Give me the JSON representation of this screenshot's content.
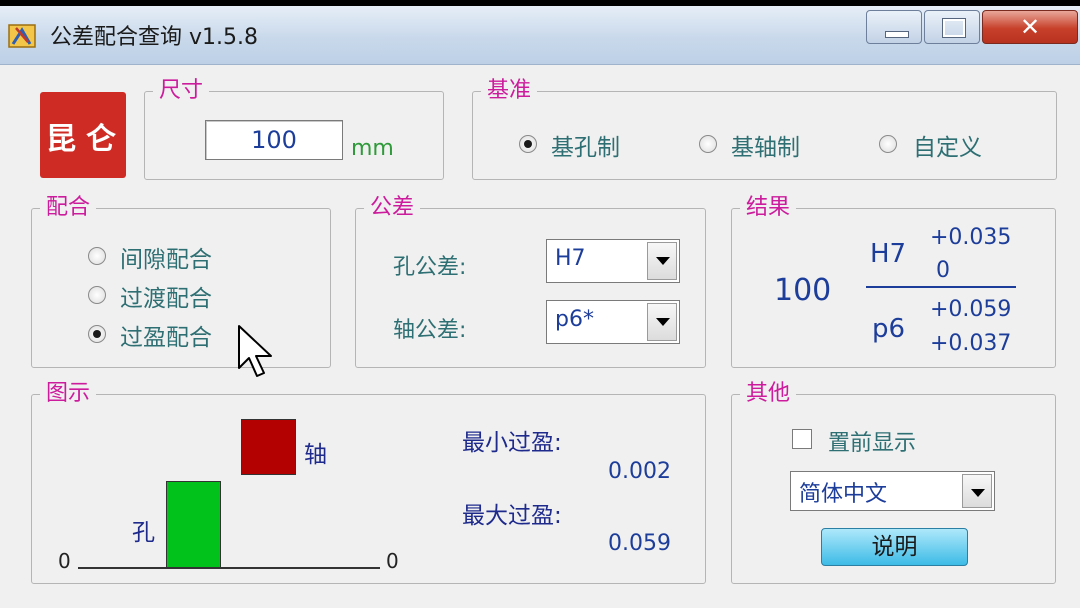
{
  "window": {
    "title": "公差配合查询  v1.5.8"
  },
  "seal": {
    "chars": [
      "昆",
      "仑"
    ]
  },
  "size": {
    "legend": "尺寸",
    "value": "100",
    "unit": "mm"
  },
  "basis": {
    "legend": "基准",
    "options": [
      {
        "label": "基孔制",
        "selected": true
      },
      {
        "label": "基轴制",
        "selected": false
      },
      {
        "label": "自定义",
        "selected": false
      }
    ]
  },
  "fit": {
    "legend": "配合",
    "options": [
      {
        "label": "间隙配合",
        "selected": false
      },
      {
        "label": "过渡配合",
        "selected": false
      },
      {
        "label": "过盈配合",
        "selected": true
      }
    ]
  },
  "tolerance": {
    "legend": "公差",
    "hole_label": "孔公差:",
    "hole_value": "H7",
    "shaft_label": "轴公差:",
    "shaft_value": "p6*"
  },
  "result": {
    "legend": "结果",
    "size": "100",
    "hole_code": "H7",
    "hole_upper": "+0.035",
    "hole_lower": "0",
    "shaft_code": "p6",
    "shaft_upper": "+0.059",
    "shaft_lower": "+0.037"
  },
  "diagram": {
    "legend": "图示",
    "shaft_label": "轴",
    "hole_label": "孔",
    "axis_left": "0",
    "axis_right": "0",
    "hole_color": "#00c21a",
    "shaft_color": "#b30000",
    "min_label": "最小过盈:",
    "min_value": "0.002",
    "max_label": "最大过盈:",
    "max_value": "0.059"
  },
  "other": {
    "legend": "其他",
    "topmost_label": "置前显示",
    "topmost_checked": false,
    "language": "简体中文",
    "explain_button": "说明"
  }
}
